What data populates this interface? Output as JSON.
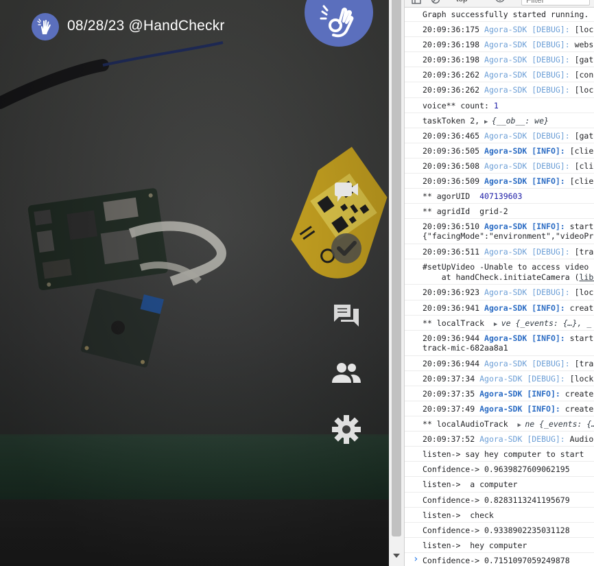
{
  "app": {
    "title": "08/28/23 @HandCheckr",
    "accent_color": "#5b6fbd",
    "logo_icon": "hand-gesture-icon",
    "fab_icon": "ok-hand-icon"
  },
  "side_controls": [
    {
      "name": "video-camera-button",
      "icon": "video-camera-icon"
    },
    {
      "name": "check-button",
      "icon": "check-circle-icon"
    },
    {
      "name": "chat-button",
      "icon": "chat-icon"
    },
    {
      "name": "people-button",
      "icon": "people-icon"
    },
    {
      "name": "settings-button",
      "icon": "gear-icon"
    }
  ],
  "devtools": {
    "context": "top",
    "filter_placeholder": "Filter",
    "prompt": "›"
  },
  "console_lines": [
    {
      "parts": [
        {
          "c": "msg",
          "t": "Graph successfully started running."
        }
      ]
    },
    {
      "parts": [
        {
          "c": "ts",
          "t": "20:09:36:175 "
        },
        {
          "c": "src",
          "t": "Agora-SDK [DEBUG]: "
        },
        {
          "c": "msg",
          "t": "[lock"
        }
      ]
    },
    {
      "parts": [
        {
          "c": "ts",
          "t": "20:09:36:198 "
        },
        {
          "c": "src",
          "t": "Agora-SDK [DEBUG]: "
        },
        {
          "c": "msg",
          "t": "websc"
        }
      ]
    },
    {
      "parts": [
        {
          "c": "ts",
          "t": "20:09:36:198 "
        },
        {
          "c": "src",
          "t": "Agora-SDK [DEBUG]: "
        },
        {
          "c": "msg",
          "t": "[gate"
        }
      ]
    },
    {
      "parts": [
        {
          "c": "ts",
          "t": "20:09:36:262 "
        },
        {
          "c": "src",
          "t": "Agora-SDK [DEBUG]: "
        },
        {
          "c": "msg",
          "t": "[cont"
        }
      ]
    },
    {
      "parts": [
        {
          "c": "ts",
          "t": "20:09:36:262 "
        },
        {
          "c": "src",
          "t": "Agora-SDK [DEBUG]: "
        },
        {
          "c": "msg",
          "t": "[lock"
        }
      ]
    },
    {
      "parts": [
        {
          "c": "msg",
          "t": "voice** count: "
        },
        {
          "c": "num",
          "t": "1"
        }
      ]
    },
    {
      "parts": [
        {
          "c": "msg",
          "t": "taskToken 2, "
        },
        {
          "c": "tri",
          "t": "▶ "
        },
        {
          "c": "obj",
          "t": "{__ob__: we}"
        }
      ]
    },
    {
      "parts": [
        {
          "c": "ts",
          "t": "20:09:36:465 "
        },
        {
          "c": "src",
          "t": "Agora-SDK [DEBUG]: "
        },
        {
          "c": "msg",
          "t": "[gate"
        }
      ]
    },
    {
      "parts": [
        {
          "c": "ts",
          "t": "20:09:36:505 "
        },
        {
          "c": "src bold",
          "t": "Agora-SDK [INFO]: "
        },
        {
          "c": "msg",
          "t": "[clien"
        }
      ]
    },
    {
      "parts": [
        {
          "c": "ts",
          "t": "20:09:36:508 "
        },
        {
          "c": "src",
          "t": "Agora-SDK [DEBUG]: "
        },
        {
          "c": "msg",
          "t": "[clie"
        }
      ]
    },
    {
      "parts": [
        {
          "c": "ts",
          "t": "20:09:36:509 "
        },
        {
          "c": "src bold",
          "t": "Agora-SDK [INFO]: "
        },
        {
          "c": "msg",
          "t": "[clien"
        }
      ]
    },
    {
      "parts": [
        {
          "c": "msg",
          "t": "** agorUID  "
        },
        {
          "c": "num",
          "t": "407139603"
        }
      ]
    },
    {
      "parts": [
        {
          "c": "msg",
          "t": "** agridId  grid-2"
        }
      ]
    },
    {
      "two": true,
      "parts": [
        {
          "c": "ts",
          "t": "20:09:36:510 "
        },
        {
          "c": "src bold",
          "t": "Agora-SDK [INFO]: "
        },
        {
          "c": "msg",
          "t": "start\n{\"facingMode\":\"environment\",\"videoPro"
        }
      ]
    },
    {
      "parts": [
        {
          "c": "ts",
          "t": "20:09:36:511 "
        },
        {
          "c": "src",
          "t": "Agora-SDK [DEBUG]: "
        },
        {
          "c": "msg",
          "t": "[trac"
        }
      ]
    },
    {
      "two": true,
      "parts": [
        {
          "c": "msg",
          "t": "#setUpVideo -Unable to access video s\n    at handCheck.initiateCamera ("
        },
        {
          "c": "link",
          "t": "lib/"
        }
      ]
    },
    {
      "parts": [
        {
          "c": "ts",
          "t": "20:09:36:923 "
        },
        {
          "c": "src",
          "t": "Agora-SDK [DEBUG]: "
        },
        {
          "c": "msg",
          "t": "[lock"
        }
      ]
    },
    {
      "parts": [
        {
          "c": "ts",
          "t": "20:09:36:941 "
        },
        {
          "c": "src bold",
          "t": "Agora-SDK [INFO]: "
        },
        {
          "c": "msg",
          "t": "create"
        }
      ]
    },
    {
      "parts": [
        {
          "c": "msg",
          "t": "** localTrack  "
        },
        {
          "c": "tri",
          "t": "▶ "
        },
        {
          "c": "obj",
          "t": "ve {_events: {…}, _"
        }
      ]
    },
    {
      "two": true,
      "parts": [
        {
          "c": "ts",
          "t": "20:09:36:944 "
        },
        {
          "c": "src bold",
          "t": "Agora-SDK [INFO]: "
        },
        {
          "c": "msg",
          "t": "start\ntrack-mic-682aa8a1"
        }
      ]
    },
    {
      "parts": [
        {
          "c": "ts",
          "t": "20:09:36:944 "
        },
        {
          "c": "src",
          "t": "Agora-SDK [DEBUG]: "
        },
        {
          "c": "msg",
          "t": "[trac"
        }
      ]
    },
    {
      "parts": [
        {
          "c": "ts",
          "t": "20:09:37:34 "
        },
        {
          "c": "src",
          "t": "Agora-SDK [DEBUG]: "
        },
        {
          "c": "msg",
          "t": "[lock-"
        }
      ]
    },
    {
      "parts": [
        {
          "c": "ts",
          "t": "20:09:37:35 "
        },
        {
          "c": "src bold",
          "t": "Agora-SDK [INFO]: "
        },
        {
          "c": "msg",
          "t": "create"
        }
      ]
    },
    {
      "parts": [
        {
          "c": "ts",
          "t": "20:09:37:49 "
        },
        {
          "c": "src bold",
          "t": "Agora-SDK [INFO]: "
        },
        {
          "c": "msg",
          "t": "create"
        }
      ]
    },
    {
      "parts": [
        {
          "c": "msg",
          "t": "** localAudioTrack  "
        },
        {
          "c": "tri",
          "t": "▶ "
        },
        {
          "c": "obj",
          "t": "ne {_events: {…"
        }
      ]
    },
    {
      "parts": [
        {
          "c": "ts",
          "t": "20:09:37:52 "
        },
        {
          "c": "src",
          "t": "Agora-SDK [DEBUG]: "
        },
        {
          "c": "msg",
          "t": "AudioC"
        }
      ]
    },
    {
      "parts": [
        {
          "c": "msg",
          "t": "listen-> say hey computer to start"
        }
      ]
    },
    {
      "parts": [
        {
          "c": "msg",
          "t": "Confidence-> 0.9639827609062195"
        }
      ]
    },
    {
      "parts": [
        {
          "c": "msg",
          "t": "listen->  a computer"
        }
      ]
    },
    {
      "parts": [
        {
          "c": "msg",
          "t": "Confidence-> 0.8283113241195679"
        }
      ]
    },
    {
      "parts": [
        {
          "c": "msg",
          "t": "listen->  check"
        }
      ]
    },
    {
      "parts": [
        {
          "c": "msg",
          "t": "Confidence-> 0.9338902235031128"
        }
      ]
    },
    {
      "parts": [
        {
          "c": "msg",
          "t": "listen->  hey computer"
        }
      ]
    },
    {
      "parts": [
        {
          "c": "msg",
          "t": "Confidence-> 0.7151097059249878"
        }
      ]
    }
  ]
}
